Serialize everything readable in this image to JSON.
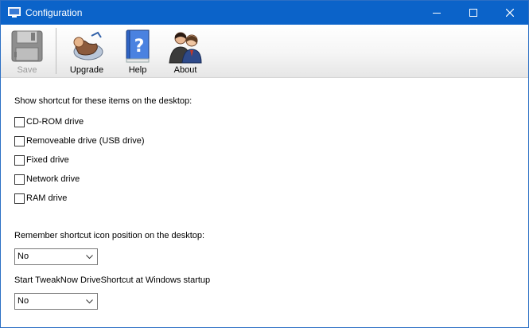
{
  "window": {
    "title": "Configuration",
    "icon": "monitor-icon",
    "controls": [
      "minimize-icon",
      "maximize-icon",
      "close-icon"
    ],
    "titlebar_color": "#0b63c9"
  },
  "toolbar": {
    "save": {
      "label": "Save",
      "icon": "floppy-disk-icon",
      "enabled": false
    },
    "upgrade": {
      "label": "Upgrade",
      "icon": "upgrade-cd-icon"
    },
    "help": {
      "label": "Help",
      "icon": "help-book-icon"
    },
    "about": {
      "label": "About",
      "icon": "people-icon"
    }
  },
  "shortcuts": {
    "heading": "Show shortcut for these items on the desktop:",
    "items": [
      {
        "label": "CD-ROM drive",
        "checked": false
      },
      {
        "label": "Removeable drive (USB drive)",
        "checked": false
      },
      {
        "label": "Fixed drive",
        "checked": false
      },
      {
        "label": "Network drive",
        "checked": false
      },
      {
        "label": "RAM drive",
        "checked": false
      }
    ]
  },
  "remember_position": {
    "label": "Remember shortcut icon position on the desktop:",
    "value": "No"
  },
  "startup": {
    "label": "Start TweakNow DriveShortcut at Windows startup",
    "value": "No"
  }
}
